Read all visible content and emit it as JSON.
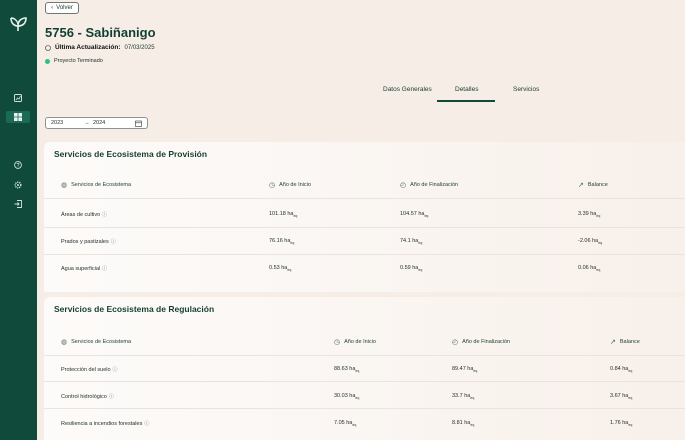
{
  "header": {
    "back_label": "Volver",
    "title": "5756 - Sabiñanigo",
    "update_label": "Última Actualización:",
    "update_date": "07/03/2025",
    "status": "Proyecto Terminado"
  },
  "tabs": [
    "Datos Generales",
    "Detalles",
    "Servicios"
  ],
  "date_range": {
    "start": "2023",
    "end": "2024"
  },
  "columns": {
    "service": "Servicios de Ecosistema",
    "start": "Año de Inicio",
    "end": "Año de Finalización",
    "balance": "Balance"
  },
  "provision": {
    "title": "Servicios de Ecosistema de Provisión",
    "rows": [
      {
        "name": "Áreas de cultivo",
        "start": "101.18",
        "end": "104.57",
        "balance": "3.39"
      },
      {
        "name": "Prados y pastizales",
        "start": "76.16",
        "end": "74.1",
        "balance": "-2.06"
      },
      {
        "name": "Agua superficial",
        "start": "0.53",
        "end": "0.59",
        "balance": "0.06"
      }
    ]
  },
  "regulation": {
    "title": "Servicios de Ecosistema de Regulación",
    "rows": [
      {
        "name": "Protección del suelo",
        "start": "88.63",
        "end": "89.47",
        "balance": "0.84"
      },
      {
        "name": "Control hidrológico",
        "start": "30.03",
        "end": "33.7",
        "balance": "3.67"
      },
      {
        "name": "Resiliencia a incendios forestales",
        "start": "7.05",
        "end": "8.81",
        "balance": "1.76"
      }
    ]
  },
  "unit": "ha",
  "unit_sub": "eq",
  "colors": {
    "sidebar": "#0f4a3a",
    "status_dot": "#2ec27e",
    "background": "#f5ede6"
  }
}
